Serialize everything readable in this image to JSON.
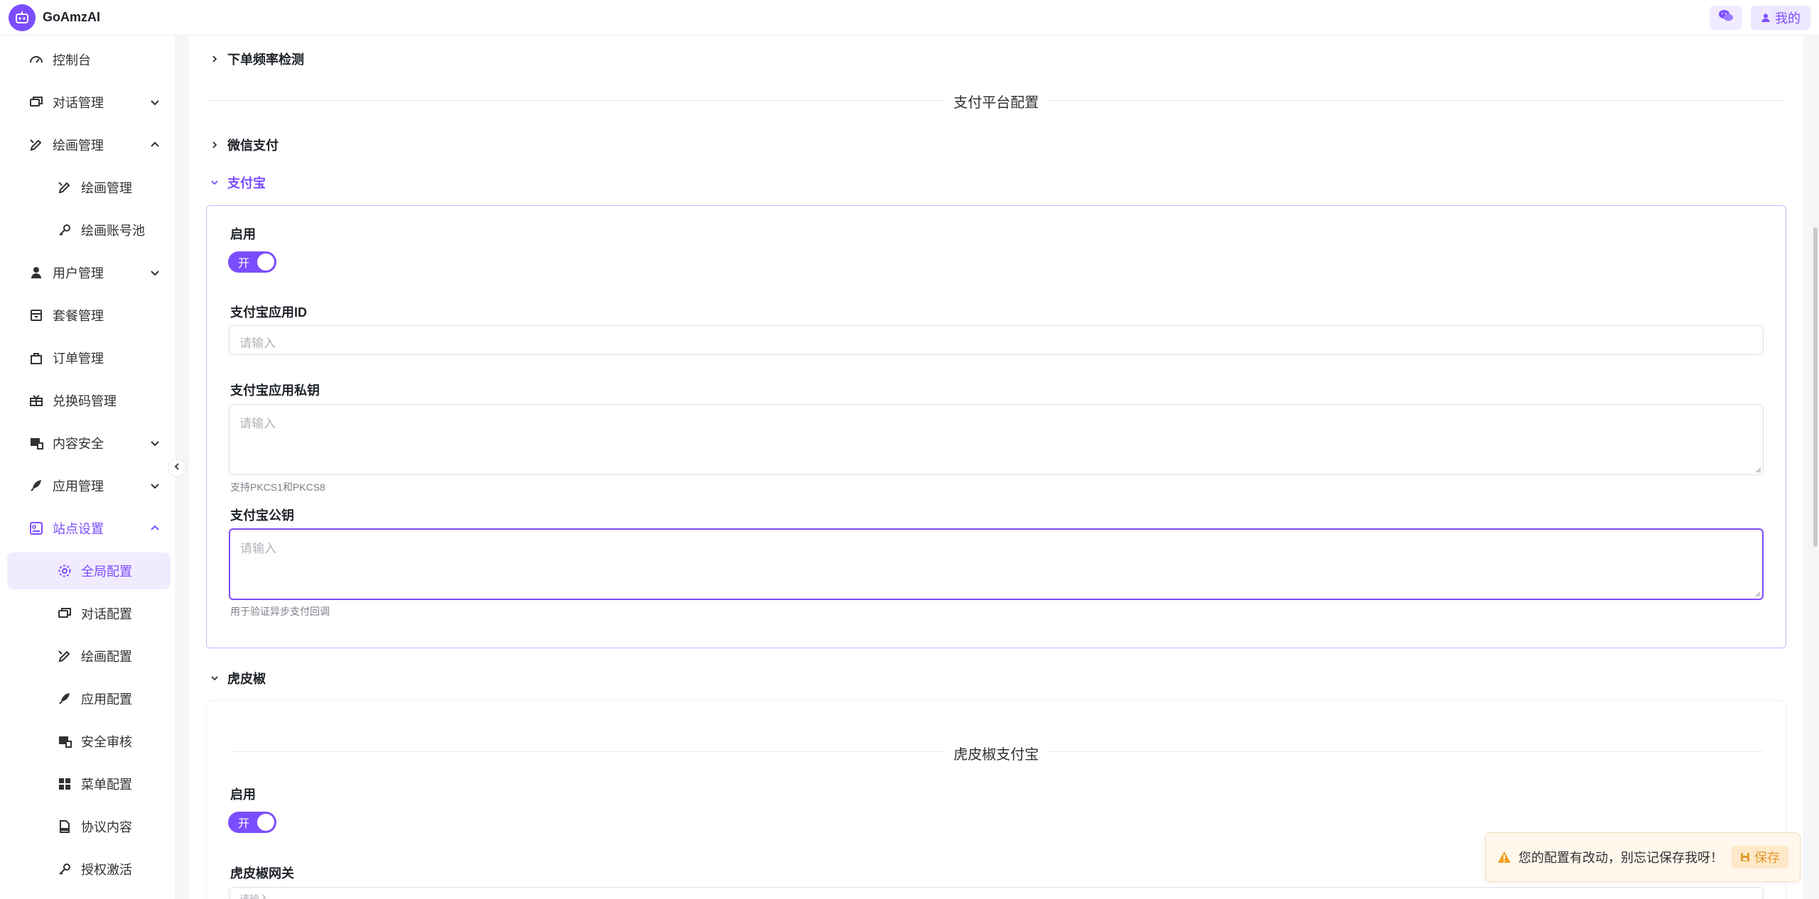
{
  "app": {
    "name": "GoAmzAI"
  },
  "header": {
    "me_label": "我的"
  },
  "sidebar": {
    "items": [
      {
        "label": "控制台"
      },
      {
        "label": "对话管理"
      },
      {
        "label": "绘画管理"
      },
      {
        "label": "绘画管理"
      },
      {
        "label": "绘画账号池"
      },
      {
        "label": "用户管理"
      },
      {
        "label": "套餐管理"
      },
      {
        "label": "订单管理"
      },
      {
        "label": "兑换码管理"
      },
      {
        "label": "内容安全"
      },
      {
        "label": "应用管理"
      },
      {
        "label": "站点设置"
      },
      {
        "label": "全局配置"
      },
      {
        "label": "对话配置"
      },
      {
        "label": "绘画配置"
      },
      {
        "label": "应用配置"
      },
      {
        "label": "安全审核"
      },
      {
        "label": "菜单配置"
      },
      {
        "label": "协议内容"
      },
      {
        "label": "授权激活"
      }
    ]
  },
  "main": {
    "order_freq_section": "下单频率检测",
    "payment_divider": "支付平台配置",
    "wechat_section": "微信支付",
    "alipay_section": "支付宝",
    "alipay": {
      "enable_label": "启用",
      "switch_text": "开",
      "app_id_label": "支付宝应用ID",
      "app_id_placeholder": "请输入",
      "private_key_label": "支付宝应用私钥",
      "private_key_placeholder": "请输入",
      "private_key_hint": "支持PKCS1和PKCS8",
      "public_key_label": "支付宝公钥",
      "public_key_placeholder": "请输入",
      "public_key_hint": "用于验证异步支付回调"
    },
    "hupijiao_section": "虎皮椒",
    "hupijiao": {
      "divider": "虎皮椒支付宝",
      "enable_label": "启用",
      "switch_text": "开",
      "gateway_label": "虎皮椒网关",
      "gateway_placeholder": "请输入"
    }
  },
  "toast": {
    "message": "您的配置有改动，别忘记保存我呀！",
    "save_label": "保存"
  },
  "colors": {
    "accent": "#7c4dff",
    "warning": "#f0a020"
  }
}
